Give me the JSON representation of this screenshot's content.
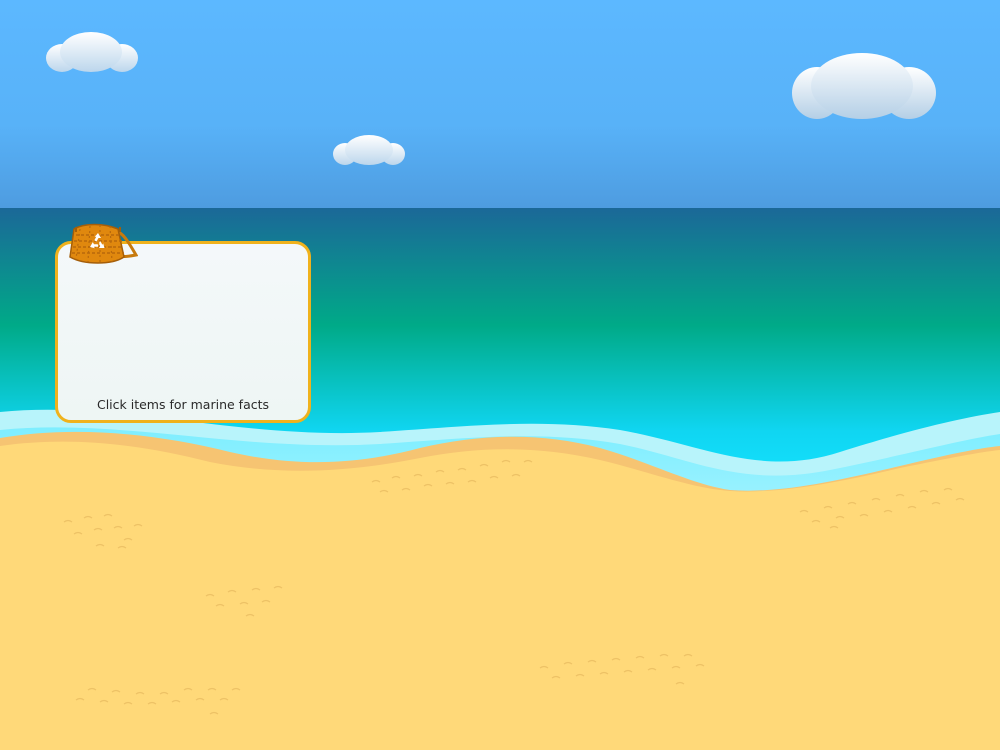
{
  "panel": {
    "hint": "Click items for marine facts",
    "border_color": "#f0b21c"
  },
  "icons": {
    "basket": "recycle-basket-icon",
    "recycle": "recycle-symbol-icon"
  },
  "colors": {
    "sky": "#5cb8ff",
    "sea_deep": "#1b6898",
    "sea_mid": "#00aa88",
    "sea_shallow": "#12dcff",
    "sand": "#ffd979",
    "wet_sand": "#f6c472",
    "foam": "#ffffff"
  }
}
